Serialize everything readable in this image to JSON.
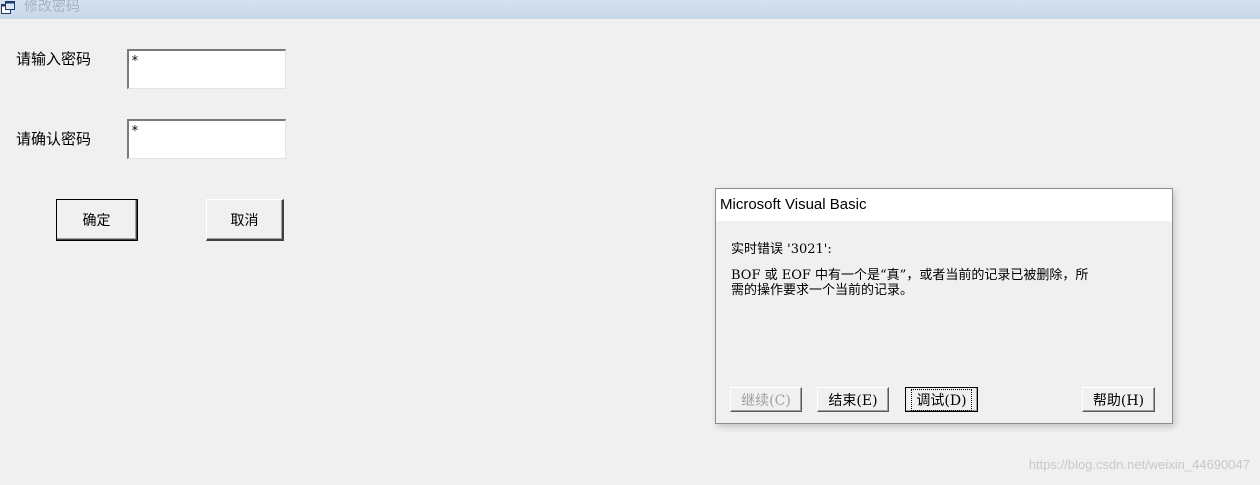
{
  "window": {
    "title": "修改密码",
    "icon": "vb-form-icon"
  },
  "form": {
    "password_label": "请输入密码",
    "password_value": "*",
    "confirm_label": "请确认密码",
    "confirm_value": "*",
    "ok_button": "确定",
    "cancel_button": "取消"
  },
  "msgbox": {
    "caption": "Microsoft Visual Basic",
    "error_line": "实时错误 '3021':",
    "message_line1": "BOF 或 EOF 中有一个是“真”，或者当前的记录已被删除，所",
    "message_line2": "需的操作要求一个当前的记录。",
    "buttons": {
      "continue": "继续(C)",
      "end": "结束(E)",
      "debug": "调试(D)",
      "help": "帮助(H)"
    }
  },
  "watermark": "https://blog.csdn.net/weixin_44690047"
}
